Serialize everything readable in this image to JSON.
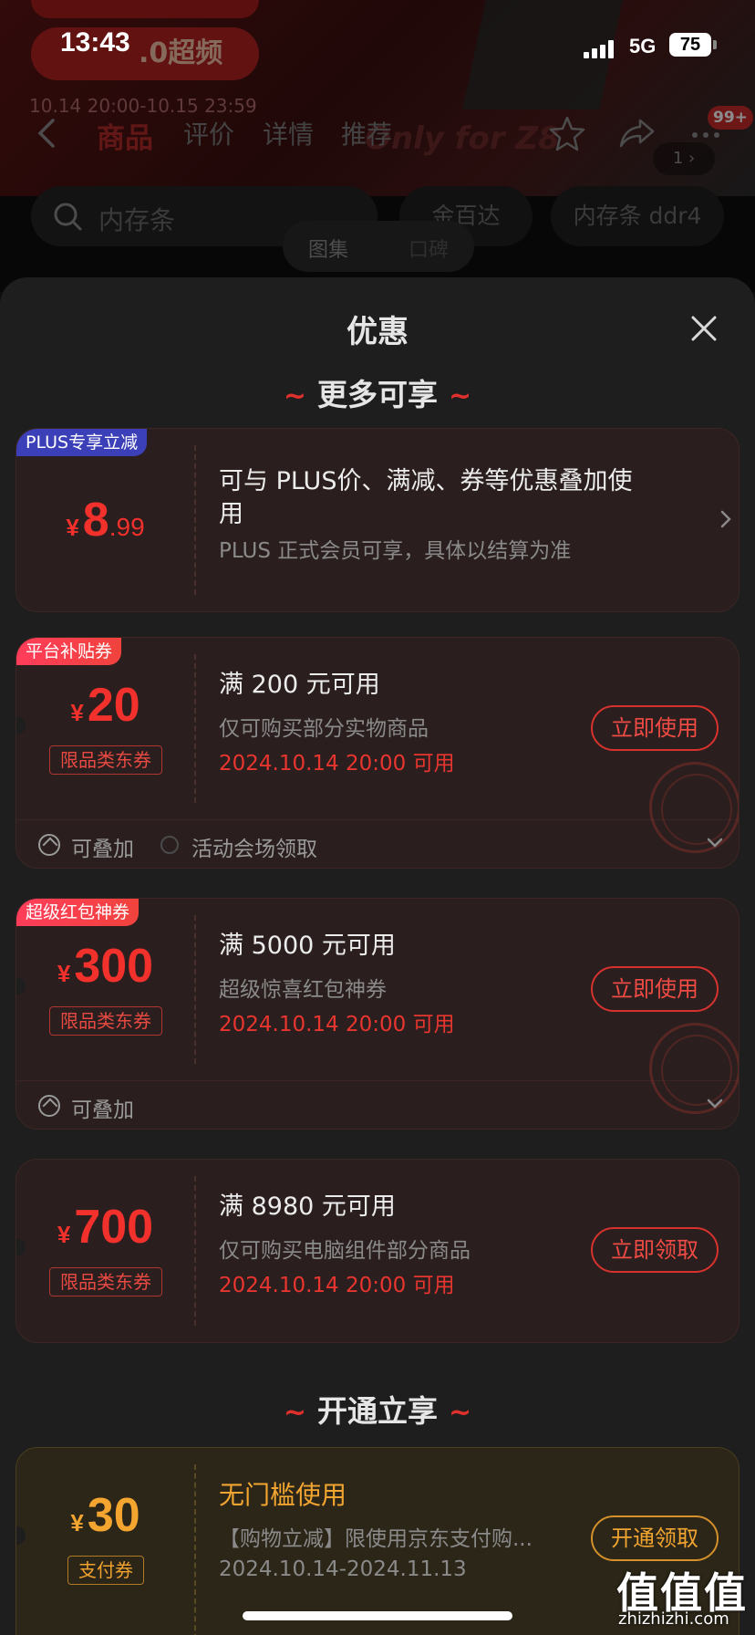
{
  "status_bar": {
    "time": "13:43",
    "network": "5G",
    "battery": "75"
  },
  "background_page": {
    "promo_badge": ".0超频",
    "promo_time": "10.14 20:00-10.15 23:59",
    "promo_slogan": "Only for Z8",
    "image_counter": "1",
    "nav_tabs": [
      "商品",
      "评价",
      "详情",
      "推荐"
    ],
    "message_badge": "99+",
    "search_placeholder": "内存条",
    "chips": [
      "金百达",
      "内存条 ddr4"
    ],
    "mini_tabs": [
      "图集",
      "口碑"
    ]
  },
  "sheet": {
    "title": "优惠",
    "section_more": "更多可享",
    "section_open": "开通立享",
    "tilde": "~"
  },
  "coupons": [
    {
      "tag": "PLUS专享立减",
      "currency": "¥",
      "amount_int": "8",
      "amount_dec": ".99",
      "title": "可与 PLUS价、满减、券等优惠叠加使用",
      "subtitle": "PLUS 正式会员可享，具体以结算为准"
    },
    {
      "tag": "平台补贴券",
      "currency": "¥",
      "amount": "20",
      "limit": "限品类东券",
      "title": "满 200 元可用",
      "subtitle": "仅可购买部分实物商品",
      "date": "2024.10.14 20:00 可用",
      "action": "立即使用",
      "foot_stack": "可叠加",
      "foot_source": "活动会场领取"
    },
    {
      "tag": "超级红包神券",
      "currency": "¥",
      "amount": "300",
      "limit": "限品类东券",
      "title": "满 5000 元可用",
      "subtitle": "超级惊喜红包神券",
      "date": "2024.10.14 20:00 可用",
      "action": "立即使用",
      "foot_stack": "可叠加"
    },
    {
      "currency": "¥",
      "amount": "700",
      "limit": "限品类东券",
      "title": "满 8980 元可用",
      "subtitle": "仅可购买电脑组件部分商品",
      "date": "2024.10.14 20:00 可用",
      "action": "立即领取"
    },
    {
      "currency": "¥",
      "amount": "30",
      "limit": "支付券",
      "title": "无门槛使用",
      "subtitle": "【购物立减】限使用京东支付购...",
      "date": "2024.10.14-2024.11.13",
      "action": "开通领取"
    }
  ],
  "watermark": {
    "logo": "值值值",
    "site": "zhizhizhi.com"
  },
  "colors": {
    "accent_red": "#f2302c",
    "gold": "#f3a530",
    "plus_blue": "#3b3fb8",
    "sheet_bg": "#1e1e1e"
  }
}
